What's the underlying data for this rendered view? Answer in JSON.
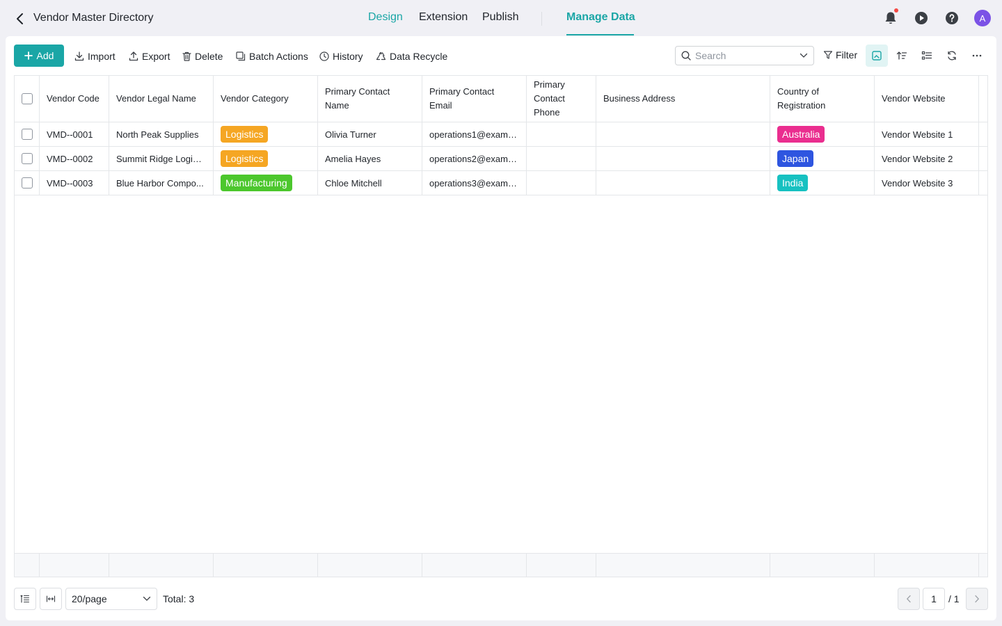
{
  "header": {
    "title": "Vendor Master Directory",
    "tabs": [
      {
        "label": "Design"
      },
      {
        "label": "Extension"
      },
      {
        "label": "Publish"
      },
      {
        "label": "Manage Data"
      }
    ],
    "active_tab": "Manage Data",
    "avatar_initial": "A",
    "icons": [
      "chevron-left-icon",
      "bell-icon",
      "play-icon",
      "help-icon"
    ]
  },
  "toolbar": {
    "add_label": "Add",
    "import_label": "Import",
    "export_label": "Export",
    "delete_label": "Delete",
    "batch_label": "Batch Actions",
    "history_label": "History",
    "recycle_label": "Data Recycle",
    "search_placeholder": "Search",
    "filter_label": "Filter"
  },
  "table": {
    "columns": [
      "Vendor Code",
      "Vendor Legal Name",
      "Vendor Category",
      "Primary Contact Name",
      "Primary Contact Email",
      "Primary Contact Phone",
      "Business Address",
      "Country of Registration",
      "Vendor Website"
    ],
    "rows": [
      {
        "code": "VMD--0001",
        "legal_name": "North Peak Supplies",
        "category": "Logistics",
        "contact": "Olivia Turner",
        "email": "operations1@examp...",
        "phone": "",
        "address": "",
        "country": "Australia",
        "website": "Vendor Website 1"
      },
      {
        "code": "VMD--0002",
        "legal_name": "Summit Ridge Logist...",
        "category": "Logistics",
        "contact": "Amelia Hayes",
        "email": "operations2@examp...",
        "phone": "",
        "address": "",
        "country": "Japan",
        "website": "Vendor Website 2"
      },
      {
        "code": "VMD--0003",
        "legal_name": "Blue Harbor Compo...",
        "category": "Manufacturing",
        "contact": "Chloe Mitchell",
        "email": "operations3@examp...",
        "phone": "",
        "address": "",
        "country": "India",
        "website": "Vendor Website 3"
      }
    ],
    "tag_colors": {
      "Logistics": "#f5a623",
      "Manufacturing": "#4cc72d",
      "Australia": "#ea2e8f",
      "Japan": "#2e55e0",
      "India": "#17c1c1"
    }
  },
  "pagination": {
    "page_size": "20/page",
    "total": "Total: 3",
    "current_page": "1",
    "total_pages": "/ 1"
  },
  "colors": {
    "accent": "#1aa6a6",
    "avatar": "#7b52e6",
    "notification": "#f54a45"
  }
}
